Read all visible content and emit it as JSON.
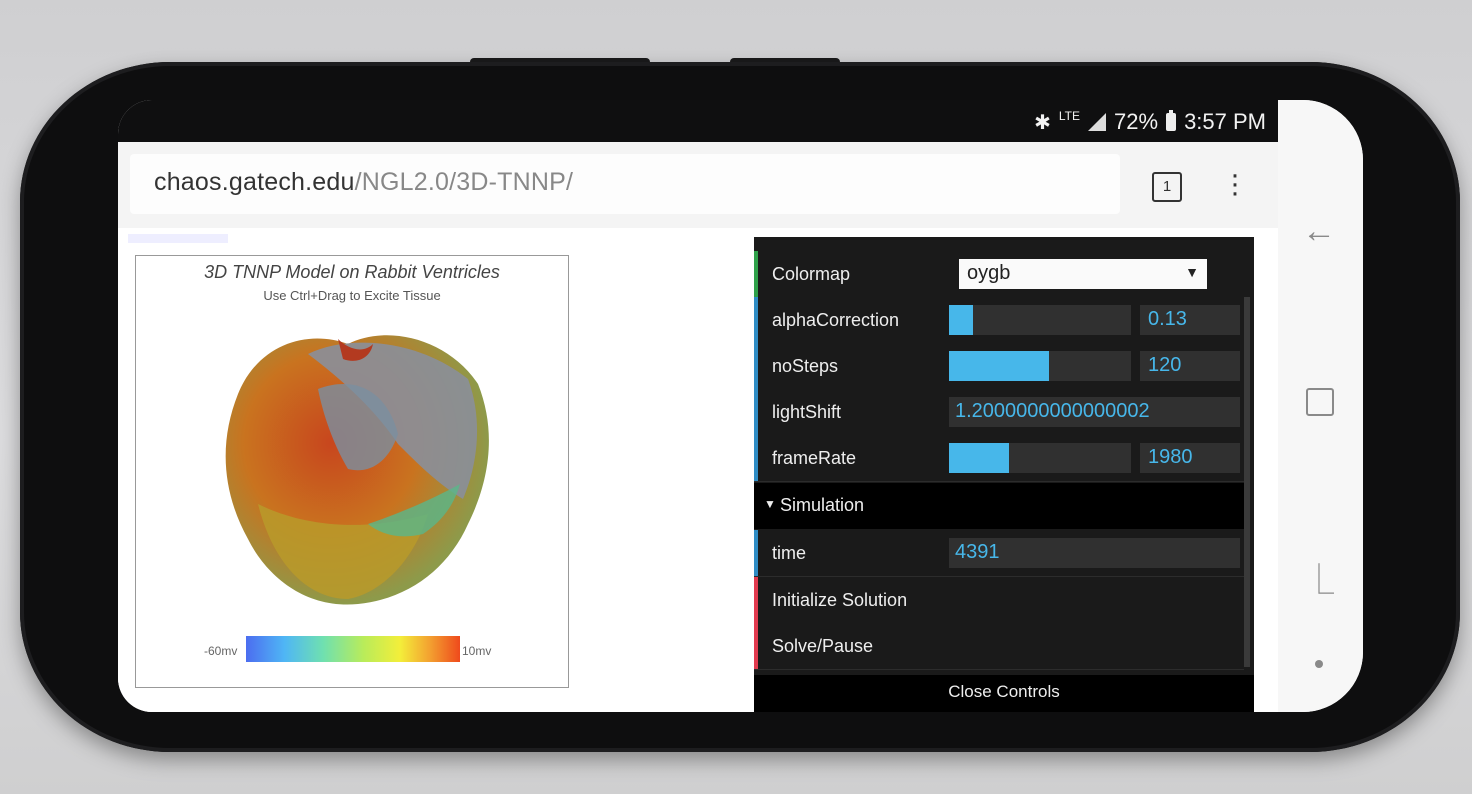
{
  "status": {
    "lte": "LTE",
    "battery": "72%",
    "time": "3:57 PM"
  },
  "browser": {
    "url_domain": "chaos.gatech.edu",
    "url_path": "/NGL2.0/3D-TNNP/",
    "tab_count": "1"
  },
  "viz": {
    "title": "3D TNNP Model on Rabbit Ventricles",
    "subtitle": "Use Ctrl+Drag to Excite Tissue",
    "colorbar_min": "-60mv",
    "colorbar_max": "10mv"
  },
  "gui": {
    "colormap": {
      "label": "Colormap",
      "value": "oygb"
    },
    "alphaCorrection": {
      "label": "alphaCorrection",
      "value": "0.13",
      "fill": 0.13
    },
    "noSteps": {
      "label": "noSteps",
      "value": "120",
      "fill": 0.55
    },
    "lightShift": {
      "label": "lightShift",
      "value": "1.2000000000000002"
    },
    "frameRate": {
      "label": "frameRate",
      "value": "1980",
      "fill": 0.33
    },
    "simulation": {
      "label": "Simulation"
    },
    "time": {
      "label": "time",
      "value": "4391"
    },
    "initialize": {
      "label": "Initialize Solution"
    },
    "solve": {
      "label": "Solve/Pause"
    },
    "close": "Close Controls"
  },
  "colors": {
    "accent": "#47b7ea",
    "panel": "#1a1a1a",
    "green": "#2fa14a",
    "red": "#e13b4f"
  }
}
